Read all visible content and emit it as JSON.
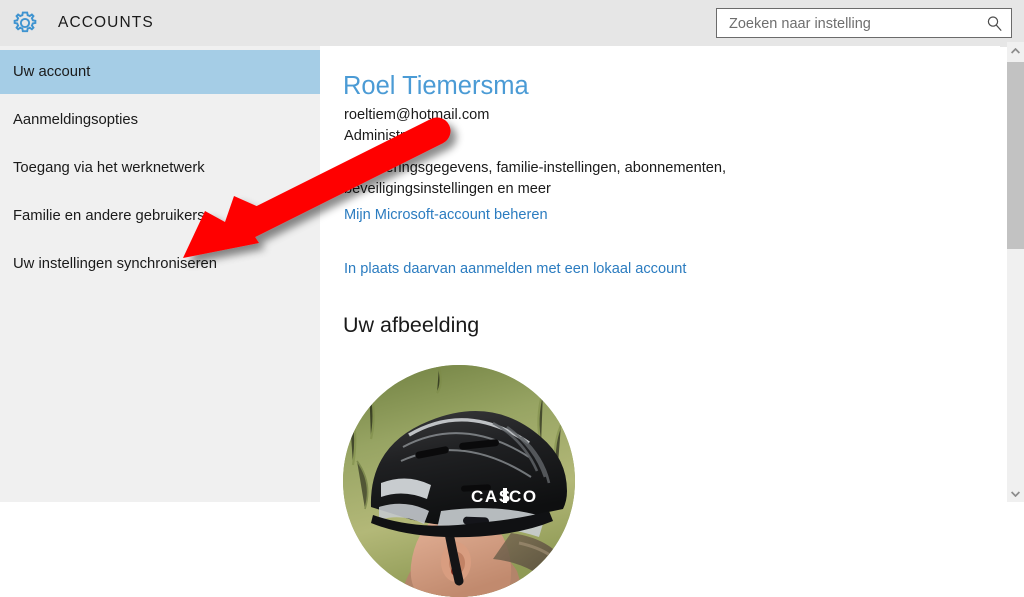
{
  "header": {
    "title": "ACCOUNTS",
    "gear_icon": "gear-icon",
    "search": {
      "placeholder": "Zoeken naar instelling",
      "value": "",
      "icon": "search-icon"
    }
  },
  "sidebar": {
    "items": [
      {
        "label": "Uw account",
        "selected": true
      },
      {
        "label": "Aanmeldingsopties",
        "selected": false
      },
      {
        "label": "Toegang via het werknetwerk",
        "selected": false
      },
      {
        "label": "Familie en andere gebruikers",
        "selected": false
      },
      {
        "label": "Uw instellingen synchroniseren",
        "selected": false
      }
    ]
  },
  "main": {
    "account_name": "Roel Tiemersma",
    "account_email": "roeltiem@hotmail.com",
    "account_role": "Administrator",
    "account_description": "Factureringsgegevens, familie-instellingen, abonnementen, beveiligingsinstellingen en meer",
    "link_manage_account": "Mijn Microsoft-account beheren",
    "link_local_account": "In plaats daarvan aanmelden met een lokaal account",
    "picture_section_title": "Uw afbeelding",
    "avatar_alt": "Foto van fietser met zwarte CASCO-helm"
  },
  "scrollbar": {
    "up_arrow": "chevron-up-icon",
    "down_arrow": "chevron-down-icon"
  },
  "annotation": {
    "type": "red-arrow",
    "color": "#ff0000",
    "points_to": "Uw instellingen synchroniseren"
  },
  "colors": {
    "accent_blue": "#4b9bd5",
    "link_blue": "#2b7cc0",
    "selected_item": "#a5cde6",
    "sidebar_bg": "#f0f0f0",
    "header_bg": "#e6e6e6",
    "annotation_red": "#ff0000"
  }
}
